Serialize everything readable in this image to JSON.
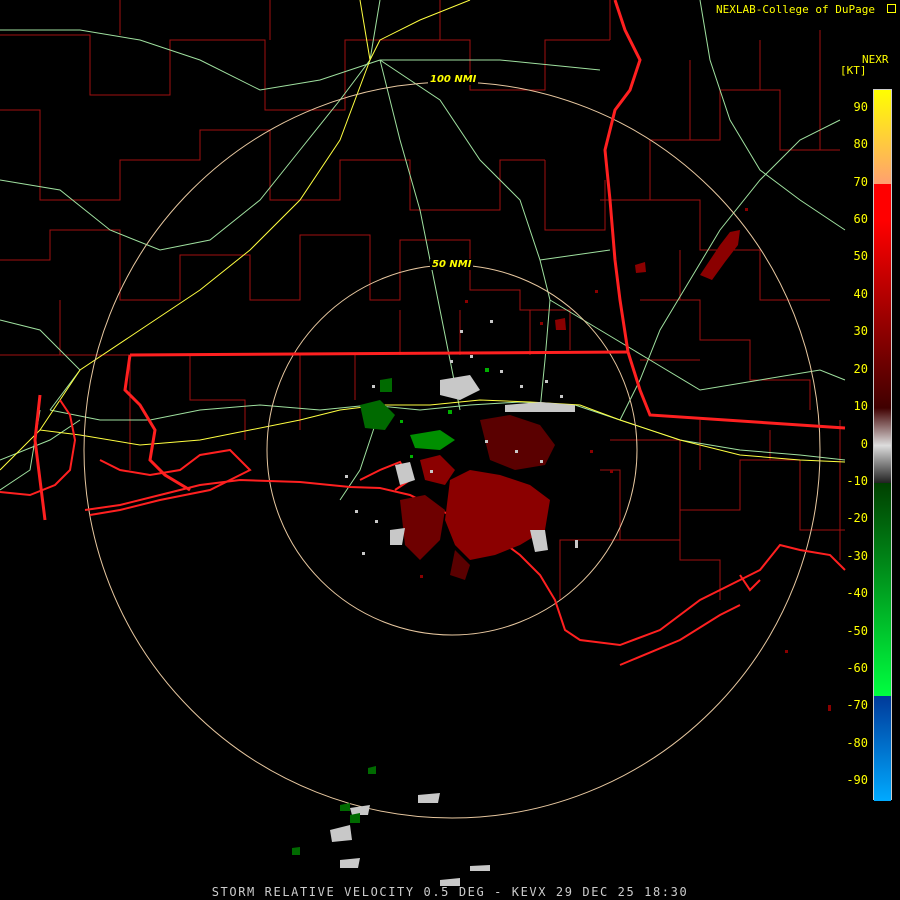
{
  "header": {
    "credit": "NEXLAB-College of DuPage",
    "product": "NEXR",
    "unit": "[KT]"
  },
  "range_rings": [
    {
      "label": "100 NMI"
    },
    {
      "label": "50 NMI"
    }
  ],
  "legend": {
    "ticks": [
      "90",
      "80",
      "70",
      "60",
      "50",
      "40",
      "30",
      "20",
      "10",
      "0",
      "-10",
      "-20",
      "-30",
      "-40",
      "-50",
      "-60",
      "-70",
      "-80",
      "-90"
    ],
    "segments": [
      {
        "from": 95,
        "to": 70,
        "color_top": "#ffff00",
        "color_bottom": "#ffa070"
      },
      {
        "from": 70,
        "to": 60,
        "color_top": "#ff0000",
        "color_bottom": "#ff0000"
      },
      {
        "from": 60,
        "to": 10,
        "color_top": "#ff0000",
        "color_bottom": "#400000"
      },
      {
        "from": 10,
        "to": -10,
        "color_top": "#400000",
        "color_bottom": "#222222",
        "mid": "#dddddd"
      },
      {
        "from": -10,
        "to": -67,
        "color_top": "#004000",
        "color_bottom": "#00ff40"
      },
      {
        "from": -67,
        "to": -95,
        "color_top": "#003a9a",
        "color_bottom": "#00aaff"
      }
    ]
  },
  "footer": {
    "text": "STORM RELATIVE VELOCITY 0.5 DEG - KEVX 29 DEC 25 18:30"
  },
  "colors": {
    "state_border": "#ff2020",
    "county_border": "#b01010",
    "highway": "#ffff40",
    "road": "#9fe09f",
    "range_ring": "#e8c8a0",
    "label": "#ffff00"
  }
}
